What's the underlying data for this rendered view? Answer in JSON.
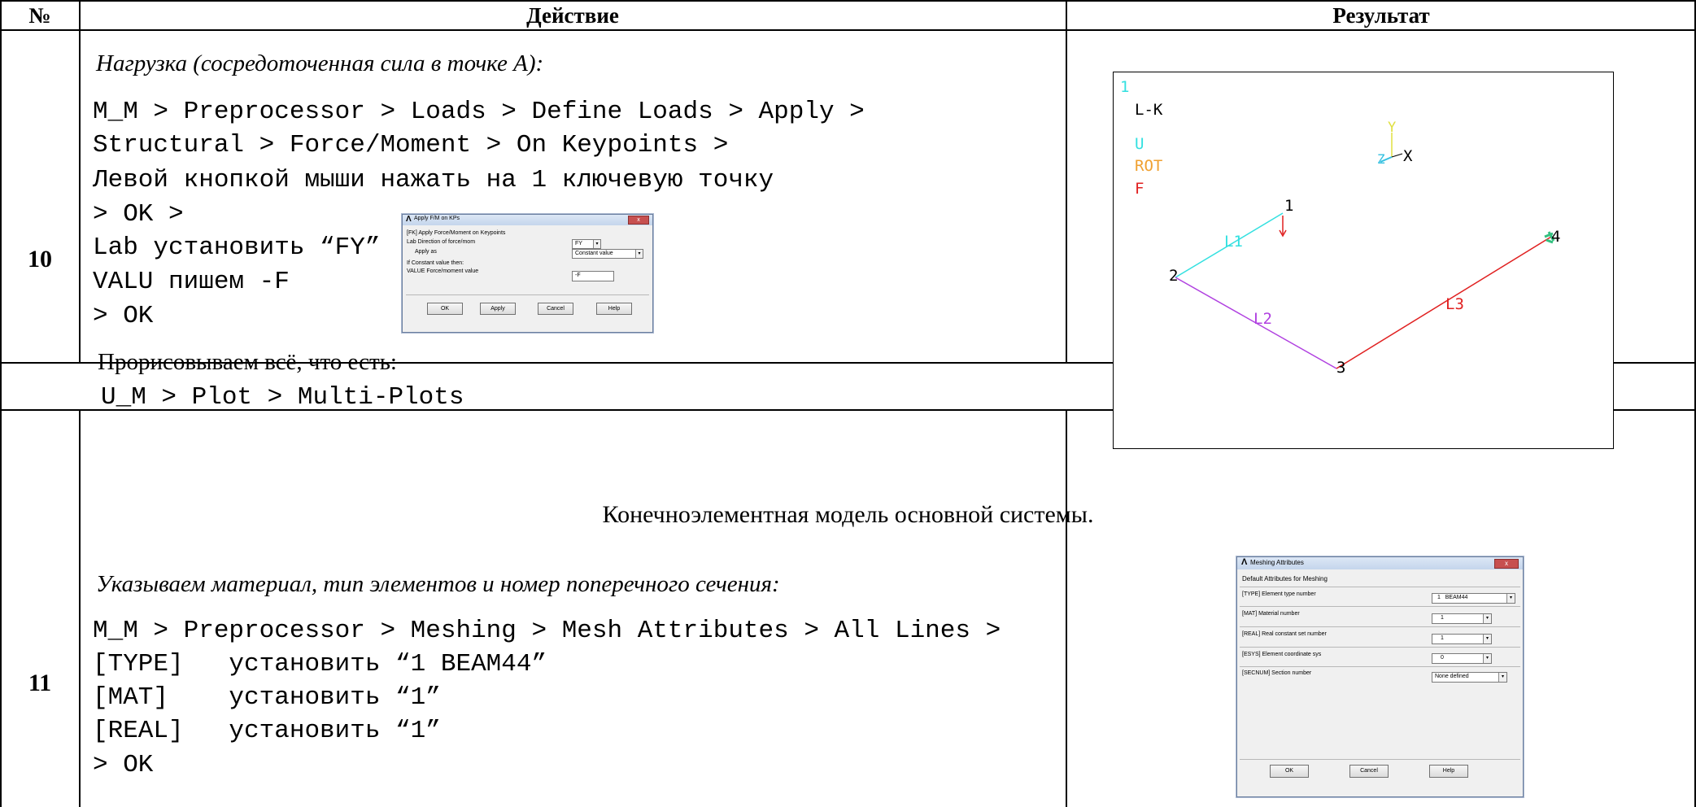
{
  "table": {
    "headers": {
      "num": "№",
      "action": "Действие",
      "result": "Результат"
    },
    "rows": [
      {
        "num": "10",
        "caption": "Нагрузка (сосредоточенная сила в точке А):",
        "lines": [
          "M_M > Preprocessor > Loads > Define Loads > Apply >",
          "Structural > Force/Moment > On Keypoints >",
          "Левой кнопкой мыши нажать на 1 ключевую точку",
          "> OK >",
          "Lab установить “FY”",
          "VALU пишем -F",
          "> OK"
        ],
        "note": "Прорисовываем всё, что есть:",
        "note_cmd": "U_M > Plot > Multi-Plots"
      },
      {
        "num": "11",
        "caption": "Указываем материал, тип элементов и номер поперечного сечения:",
        "lines": [
          "M_M > Preprocessor > Meshing > Mesh Attributes > All Lines >",
          "[TYPE]   установить “1 BEAM44”",
          "[MAT]    установить “1”",
          "[REAL]   установить “1”",
          "> OK"
        ]
      }
    ],
    "section_title": "Конечноэлементная модель основной системы."
  },
  "dialog_fk": {
    "title": "Apply F/M on KPs",
    "heading": "[FK]  Apply Force/Moment on Keypoints",
    "lab_label": "Lab    Direction of force/mom",
    "lab_value": "FY",
    "apply_as_label": "Apply as",
    "apply_as_value": "Constant value",
    "if_constant": "If Constant value then:",
    "value_label": "VALUE  Force/moment value",
    "value_value": "-F",
    "buttons": [
      "OK",
      "Apply",
      "Cancel",
      "Help"
    ]
  },
  "plot": {
    "window_number": "1",
    "mode": "L-K",
    "legend": [
      {
        "text": "U",
        "color": "#33e0e0"
      },
      {
        "text": "ROT",
        "color": "#f0a030"
      },
      {
        "text": "F",
        "color": "#e02020"
      }
    ],
    "axes": {
      "y": "Y",
      "z": "Z",
      "x": "X"
    },
    "keypoints": [
      "1",
      "2",
      "3",
      "4"
    ],
    "lines": [
      {
        "label": "L1",
        "color": "#33e0e0"
      },
      {
        "label": "L2",
        "color": "#b040e0"
      },
      {
        "label": "L3",
        "color": "#e02020"
      }
    ]
  },
  "dialog_mesh": {
    "title": "Meshing Attributes",
    "heading": "Default Attributes for Meshing",
    "rows": [
      {
        "label": "[TYPE]  Element type number",
        "value": "1   BEAM44"
      },
      {
        "label": "[MAT]   Material number",
        "value": "1"
      },
      {
        "label": "[REAL]  Real constant set number",
        "value": "1"
      },
      {
        "label": "[ESYS]  Element coordinate sys",
        "value": "0"
      },
      {
        "label": "[SECNUM]  Section number",
        "value": "None defined"
      }
    ],
    "buttons": [
      "OK",
      "Cancel",
      "Help"
    ]
  }
}
